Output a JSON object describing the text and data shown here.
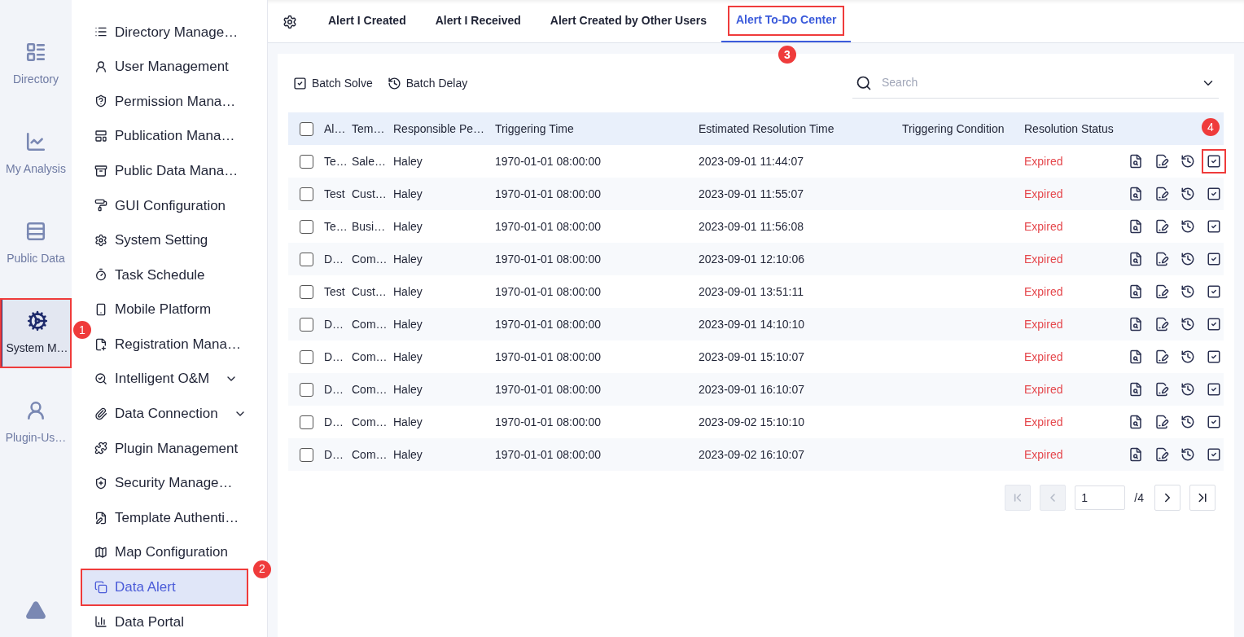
{
  "rail": [
    {
      "label": "Directory",
      "selected": false
    },
    {
      "label": "My Analysis",
      "selected": false
    },
    {
      "label": "Public Data",
      "selected": false
    },
    {
      "label": "System M…",
      "selected": true,
      "callout": "1"
    },
    {
      "label": "Plugin-Us…",
      "selected": false
    }
  ],
  "sidebar": {
    "items": [
      {
        "label": "Directory Manage…",
        "selected": false,
        "expandable": false
      },
      {
        "label": "User Management",
        "selected": false,
        "expandable": false
      },
      {
        "label": "Permission Mana…",
        "selected": false,
        "expandable": false
      },
      {
        "label": "Publication Mana…",
        "selected": false,
        "expandable": false
      },
      {
        "label": "Public Data Mana…",
        "selected": false,
        "expandable": false
      },
      {
        "label": "GUI Configuration",
        "selected": false,
        "expandable": false
      },
      {
        "label": "System Setting",
        "selected": false,
        "expandable": false
      },
      {
        "label": "Task Schedule",
        "selected": false,
        "expandable": false
      },
      {
        "label": "Mobile Platform",
        "selected": false,
        "expandable": false
      },
      {
        "label": "Registration Mana…",
        "selected": false,
        "expandable": false
      },
      {
        "label": "Intelligent O&M",
        "selected": false,
        "expandable": true
      },
      {
        "label": "Data Connection",
        "selected": false,
        "expandable": true
      },
      {
        "label": "Plugin Management",
        "selected": false,
        "expandable": false
      },
      {
        "label": "Security Manage…",
        "selected": false,
        "expandable": false
      },
      {
        "label": "Template Authenti…",
        "selected": false,
        "expandable": false
      },
      {
        "label": "Map Configuration",
        "selected": false,
        "expandable": false
      },
      {
        "label": "Data Alert",
        "selected": true,
        "expandable": false,
        "callout": "2"
      },
      {
        "label": "Data Portal",
        "selected": false,
        "expandable": false
      }
    ]
  },
  "tabs": [
    {
      "label": "Alert I Created",
      "selected": false
    },
    {
      "label": "Alert I Received",
      "selected": false
    },
    {
      "label": "Alert Created by Other Users",
      "selected": false
    },
    {
      "label": "Alert To-Do Center",
      "selected": true,
      "callout": "3"
    }
  ],
  "toolbar": {
    "batch_solve": "Batch Solve",
    "batch_delay": "Batch Delay",
    "search": {
      "placeholder": "Search"
    }
  },
  "table": {
    "select_all_checked": false,
    "columns": [
      "Al…",
      "Tem…",
      "Responsible Pe…",
      "Triggering Time",
      "Estimated Resolution Time",
      "Triggering Condition",
      "Resolution Status"
    ],
    "rows": [
      {
        "checked": false,
        "cells": [
          "Te…",
          "Sale…",
          "Haley",
          "1970-01-01 08:00:00",
          "2023-09-01 11:44:07",
          "",
          "Expired"
        ],
        "callout": "4"
      },
      {
        "checked": false,
        "cells": [
          "Test",
          "Cust…",
          "Haley",
          "1970-01-01 08:00:00",
          "2023-09-01 11:55:07",
          "",
          "Expired"
        ]
      },
      {
        "checked": false,
        "cells": [
          "Te…",
          "Busi…",
          "Haley",
          "1970-01-01 08:00:00",
          "2023-09-01 11:56:08",
          "",
          "Expired"
        ]
      },
      {
        "checked": false,
        "cells": [
          "D…",
          "Com…",
          "Haley",
          "1970-01-01 08:00:00",
          "2023-09-01 12:10:06",
          "",
          "Expired"
        ]
      },
      {
        "checked": false,
        "cells": [
          "Test",
          "Cust…",
          "Haley",
          "1970-01-01 08:00:00",
          "2023-09-01 13:51:11",
          "",
          "Expired"
        ]
      },
      {
        "checked": false,
        "cells": [
          "D…",
          "Com…",
          "Haley",
          "1970-01-01 08:00:00",
          "2023-09-01 14:10:10",
          "",
          "Expired"
        ]
      },
      {
        "checked": false,
        "cells": [
          "D…",
          "Com…",
          "Haley",
          "1970-01-01 08:00:00",
          "2023-09-01 15:10:07",
          "",
          "Expired"
        ]
      },
      {
        "checked": false,
        "cells": [
          "D…",
          "Com…",
          "Haley",
          "1970-01-01 08:00:00",
          "2023-09-01 16:10:07",
          "",
          "Expired"
        ]
      },
      {
        "checked": false,
        "cells": [
          "D…",
          "Com…",
          "Haley",
          "1970-01-01 08:00:00",
          "2023-09-02 15:10:10",
          "",
          "Expired"
        ]
      },
      {
        "checked": false,
        "cells": [
          "D…",
          "Com…",
          "Haley",
          "1970-01-01 08:00:00",
          "2023-09-02 16:10:07",
          "",
          "Expired"
        ]
      }
    ]
  },
  "pagination": {
    "page": "1",
    "total": "/4",
    "buttons": [
      {
        "kind": "first",
        "disabled": true
      },
      {
        "kind": "prev",
        "disabled": true
      },
      {
        "kind": "next",
        "disabled": false
      },
      {
        "kind": "last",
        "disabled": false
      }
    ]
  }
}
